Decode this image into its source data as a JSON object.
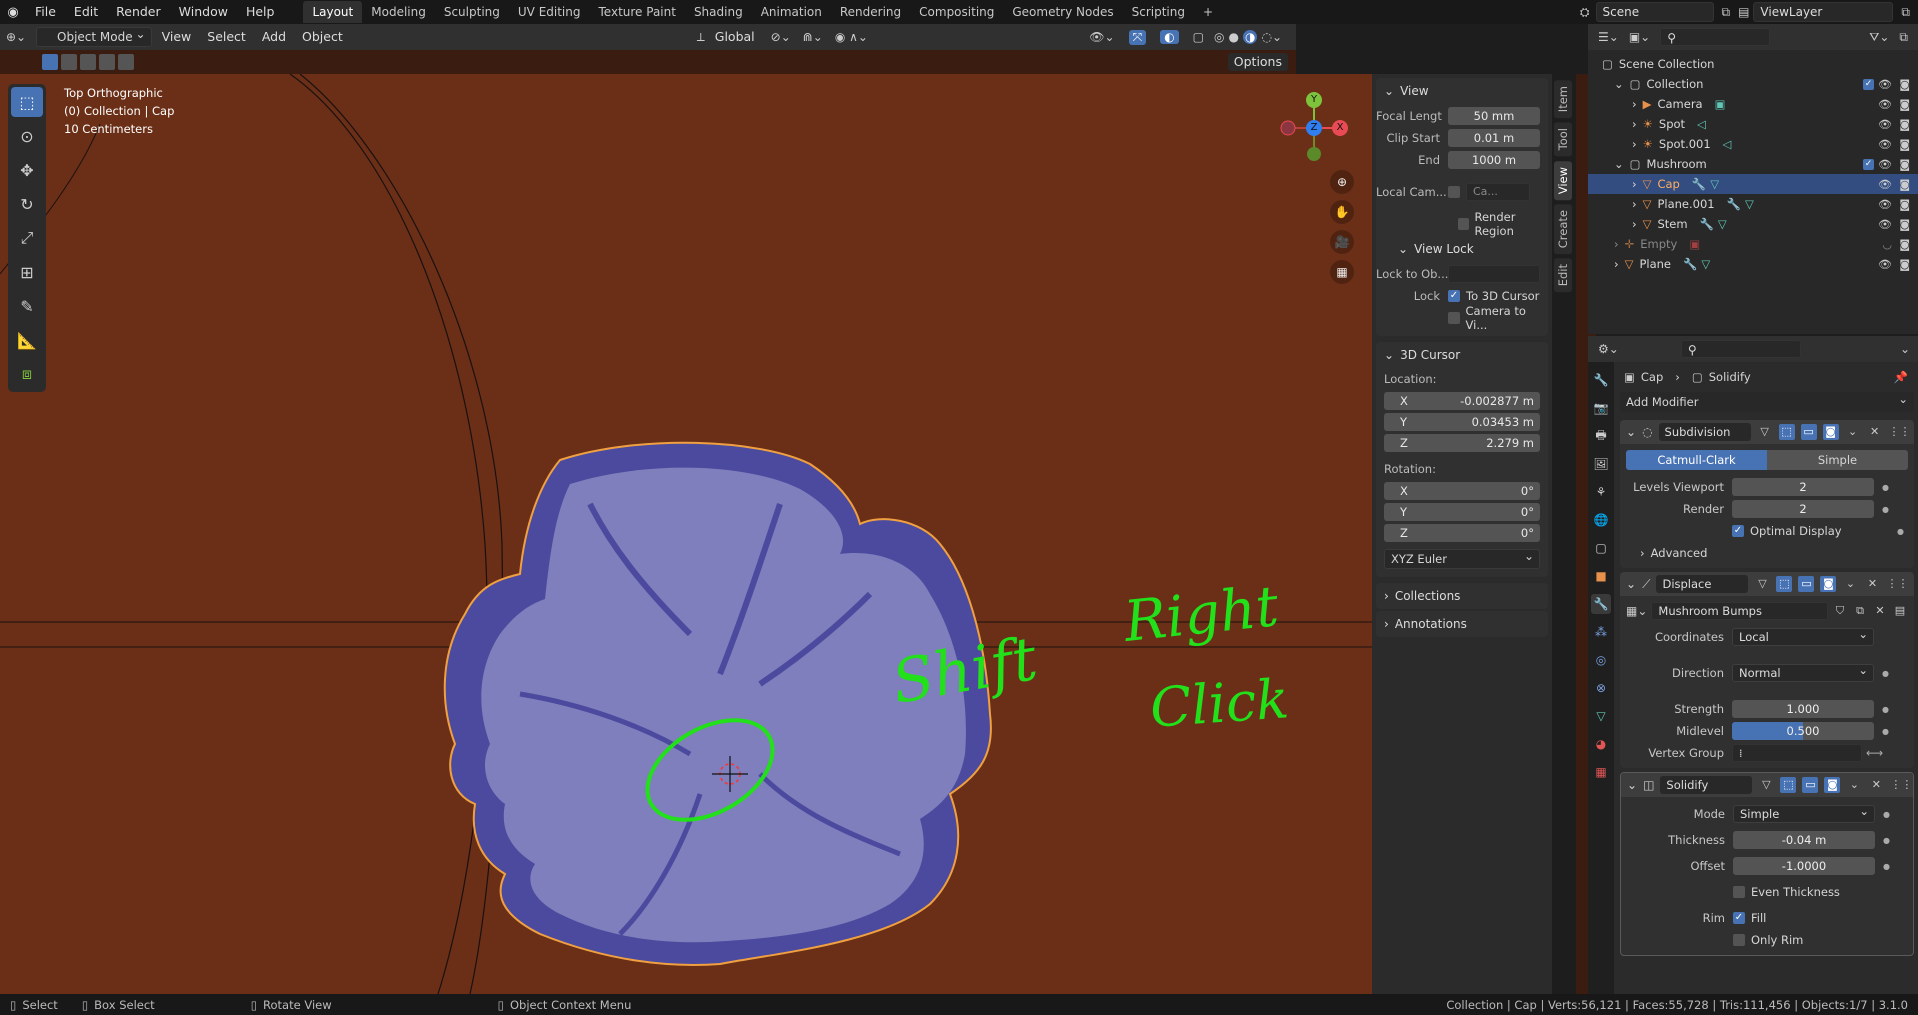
{
  "topbar": {
    "menus": [
      "File",
      "Edit",
      "Render",
      "Window",
      "Help"
    ],
    "workspaces": [
      "Layout",
      "Modeling",
      "Sculpting",
      "UV Editing",
      "Texture Paint",
      "Shading",
      "Animation",
      "Rendering",
      "Compositing",
      "Geometry Nodes",
      "Scripting"
    ],
    "add_tab": "+",
    "scene": "Scene",
    "view_layer": "ViewLayer"
  },
  "viewport_header": {
    "mode": "Object Mode",
    "menus": [
      "View",
      "Select",
      "Add",
      "Object"
    ],
    "orientation": "Global",
    "options": "Options"
  },
  "overlay_text": {
    "view_name": "Top Orthographic",
    "collection": "(0) Collection | Cap",
    "scale": "10 Centimeters"
  },
  "annotation": {
    "word1": "Shift",
    "word2": "Right",
    "word3": "Click",
    "color": "#22e01a"
  },
  "gizmo": {
    "y": "Y",
    "z": "Z",
    "x": "X"
  },
  "npanel": {
    "tabs": [
      "Item",
      "Tool",
      "View",
      "Create",
      "Edit"
    ],
    "view": {
      "title": "View",
      "focal_label": "Focal Lengt",
      "focal_value": "50 mm",
      "clip_start_label": "Clip Start",
      "clip_start_value": "0.01 m",
      "end_label": "End",
      "end_value": "1000 m",
      "local_cam_label": "Local Cam...",
      "local_cam_value": "Ca...",
      "render_region": "Render Region"
    },
    "view_lock": {
      "title": "View Lock",
      "lock_to_obj_label": "Lock to Ob...",
      "lock_label": "Lock",
      "to_3d_cursor": "To 3D Cursor",
      "camera_to_view": "Camera to Vi..."
    },
    "cursor": {
      "title": "3D Cursor",
      "location_label": "Location:",
      "loc": [
        {
          "axis": "X",
          "value": "-0.002877 m"
        },
        {
          "axis": "Y",
          "value": "0.03453 m"
        },
        {
          "axis": "Z",
          "value": "2.279 m"
        }
      ],
      "rotation_label": "Rotation:",
      "rot": [
        {
          "axis": "X",
          "value": "0°"
        },
        {
          "axis": "Y",
          "value": "0°"
        },
        {
          "axis": "Z",
          "value": "0°"
        }
      ],
      "rotation_mode": "XYZ Euler"
    },
    "collections": "Collections",
    "annotations": "Annotations"
  },
  "outliner": {
    "scene_collection": "Scene Collection",
    "rows": [
      {
        "label": "Collection",
        "indent": 1
      },
      {
        "label": "Camera",
        "indent": 2
      },
      {
        "label": "Spot",
        "indent": 2
      },
      {
        "label": "Spot.001",
        "indent": 2
      },
      {
        "label": "Mushroom",
        "indent": 1
      },
      {
        "label": "Cap",
        "indent": 2
      },
      {
        "label": "Plane.001",
        "indent": 2
      },
      {
        "label": "Stem",
        "indent": 2
      },
      {
        "label": "Empty",
        "indent": 1
      },
      {
        "label": "Plane",
        "indent": 1
      }
    ]
  },
  "properties": {
    "breadcrumb_object": "Cap",
    "breadcrumb_modifier": "Solidify",
    "add_modifier": "Add Modifier",
    "subdivision": {
      "name": "Subdivision",
      "catmull": "Catmull-Clark",
      "simple": "Simple",
      "levels_viewport_label": "Levels Viewport",
      "levels_viewport": "2",
      "render_label": "Render",
      "render": "2",
      "optimal_display": "Optimal Display",
      "advanced": "Advanced"
    },
    "displace": {
      "name": "Displace",
      "texture": "Mushroom Bumps",
      "coordinates_label": "Coordinates",
      "coordinates": "Local",
      "direction_label": "Direction",
      "direction": "Normal",
      "strength_label": "Strength",
      "strength": "1.000",
      "midlevel_label": "Midlevel",
      "midlevel": "0.500",
      "midlevel_fraction": 0.5,
      "vertex_group_label": "Vertex Group"
    },
    "solidify": {
      "name": "Solidify",
      "mode_label": "Mode",
      "mode": "Simple",
      "thickness_label": "Thickness",
      "thickness": "-0.04 m",
      "offset_label": "Offset",
      "offset": "-1.0000",
      "even_thickness": "Even Thickness",
      "rim_label": "Rim",
      "fill": "Fill",
      "only_rim": "Only Rim"
    }
  },
  "statusbar": {
    "select": "Select",
    "box_select": "Box Select",
    "rotate_view": "Rotate View",
    "context_menu": "Object Context Menu",
    "stats": "Collection | Cap | Verts:56,121 | Faces:55,728 | Tris:111,456 | Objects:1/7 | 3.1.0"
  },
  "colors": {
    "viewport_bg": "#6b2f17",
    "cap_light": "#7e7fbc",
    "cap_dark": "#4b4a9e",
    "outline": "#f0a040",
    "accent": "#4772b3"
  }
}
